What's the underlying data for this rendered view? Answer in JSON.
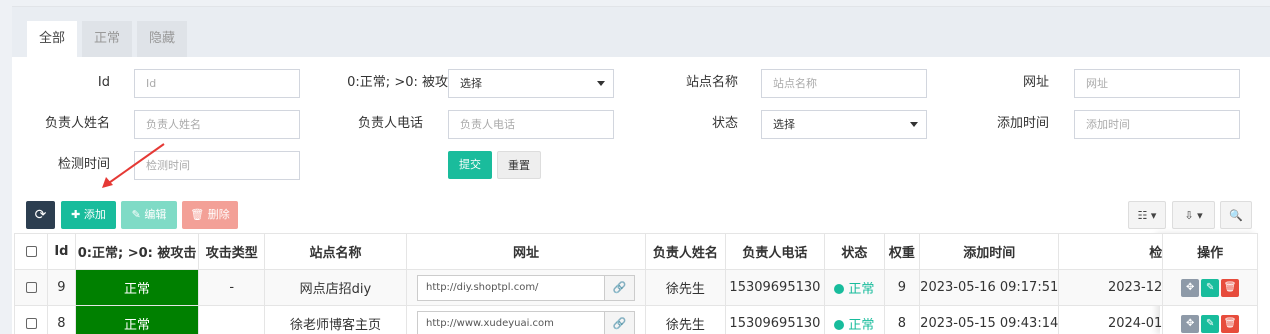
{
  "tabs": [
    {
      "label": "全部",
      "active": true
    },
    {
      "label": "正常",
      "active": false
    },
    {
      "label": "隐藏",
      "active": false
    }
  ],
  "filters": {
    "id": {
      "label": "Id",
      "placeholder": "Id"
    },
    "attack": {
      "label": "0:正常; >0: 被攻",
      "value": "选择"
    },
    "site_name": {
      "label": "站点名称",
      "placeholder": "站点名称"
    },
    "url": {
      "label": "网址",
      "placeholder": "网址"
    },
    "owner_name": {
      "label": "负责人姓名",
      "placeholder": "负责人姓名"
    },
    "owner_phone": {
      "label": "负责人电话",
      "placeholder": "负责人电话"
    },
    "status": {
      "label": "状态",
      "value": "选择"
    },
    "add_time": {
      "label": "添加时间",
      "placeholder": "添加时间"
    },
    "check_time": {
      "label": "检测时间",
      "placeholder": "检测时间"
    },
    "submit_label": "提交",
    "reset_label": "重置"
  },
  "toolbar": {
    "add_label": "添加",
    "edit_label": "编辑",
    "delete_label": "删除"
  },
  "table": {
    "columns": [
      "Id",
      "0:正常; >0: 被攻击",
      "攻击类型",
      "站点名称",
      "网址",
      "负责人姓名",
      "负责人电话",
      "状态",
      "权重",
      "添加时间",
      "检",
      "操作"
    ],
    "rows": [
      {
        "id": "9",
        "attack": "正常",
        "attack_type": "-",
        "site": "网点店招diy",
        "url": "http://diy.shoptpl.com/",
        "owner": "徐先生",
        "phone": "15309695130",
        "status": "正常",
        "weight": "9",
        "added": "2023-05-16 09:17:51",
        "checked": "2023-12"
      },
      {
        "id": "8",
        "attack": "正常",
        "attack_type": "",
        "site": "徐老师博客主页",
        "url": "http://www.xudeyuai.com",
        "owner": "徐先生",
        "phone": "15309695130",
        "status": "正常",
        "weight": "8",
        "added": "2023-05-15 09:43:14",
        "checked": "2024-01"
      }
    ]
  },
  "colors": {
    "accent": "#18bc9c",
    "status_green": "#008000",
    "danger": "#e74c3c",
    "dark": "#2c3e50"
  }
}
